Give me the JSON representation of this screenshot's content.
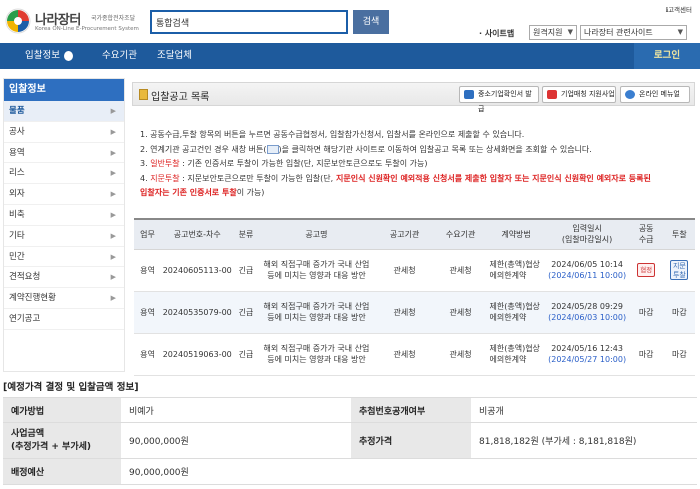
{
  "header": {
    "logo_title": "나라장터",
    "logo_sub1": "국가종합전자조달",
    "logo_sub2": "Korea ON-Line E-Procurement System",
    "search_select": "통합검색",
    "search_button": "검색",
    "help": "고객센터",
    "sitemap_label": "· 사이트맵",
    "dropdown1": "원격지원",
    "dropdown2": "나라장터 관련사이트"
  },
  "nav": {
    "items": [
      "입찰정보",
      "수요기관",
      "조달업체"
    ],
    "login": "로그인"
  },
  "sidebar": {
    "title": "입찰정보",
    "items": [
      "물품",
      "공사",
      "용역",
      "리스",
      "외자",
      "비축",
      "기타",
      "민간",
      "견적요청",
      "계약진행현황",
      "연기공고"
    ]
  },
  "content": {
    "title": "입찰공고 목록",
    "buttons": [
      "중소기업확인서 발급",
      "기업매칭 지원사업",
      "온라인 메뉴얼"
    ],
    "notices": {
      "n1": "1. 공동수급,투찰 항목의 버튼을 누르면 공동수급협정서, 입찰참가신청서, 입찰서를 온라인으로 제출할 수 있습니다.",
      "n2a": "2. 연계기관 공고건인 경우 새창 버튼(",
      "n2b": ")을 클릭하면 해당기관 사이트로 이동하여 입찰공고 목록 또는 상세화면을 조회할 수 있습니다.",
      "n3_prefix": "3. ",
      "n3_red": "일반투찰",
      "n3_rest": " : 기존 인증서로 투찰이 가능한 입찰(단, 지문보안토큰으로도 투찰이 가능)",
      "n4_prefix": "4. ",
      "n4_red": "지문투찰",
      "n4_rest": " : 지문보안토큰으로만 투찰이 가능한 입찰(단,",
      "n4_red2": " 지문인식 신원확인 예외적용 신청서를 제출한 입찰자 또는 지문인식 신원확인 예외자로 등록된",
      "n4_red3": "입찰자는 기존 인증서로 투찰",
      "n4_end": "이 가능)"
    },
    "table": {
      "headers": [
        "업무",
        "공고번호-차수",
        "분류",
        "공고명",
        "공고기관",
        "수요기관",
        "계약방법",
        "입력일시\n(입찰마감일시)",
        "공동\n수급",
        "투찰"
      ],
      "rows": [
        {
          "work": "용역",
          "no": "20240605113-00",
          "cat": "긴급",
          "name": "해외 직접구매 증가가 국내 산업 등에 미치는 영향과 대응 방안",
          "org": "관세청",
          "demand": "관세청",
          "method": "제한(총액)협상에의한계약",
          "date": "2024/06/05 10:14",
          "deadline": "(2024/06/11 10:00)",
          "joint": "협정",
          "bid": "지문\n투찰"
        },
        {
          "work": "용역",
          "no": "20240535079-00",
          "cat": "긴급",
          "name": "해외 직접구매 증가가 국내 산업 등에 미치는 영향과 대응 방안",
          "org": "관세청",
          "demand": "관세청",
          "method": "제한(총액)협상에의한계약",
          "date": "2024/05/28 09:29",
          "deadline": "(2024/06/03 10:00)",
          "joint": "마감",
          "bid": "마감"
        },
        {
          "work": "용역",
          "no": "20240519063-00",
          "cat": "긴급",
          "name": "해외 직접구매 증가가 국내 산업 등에 미치는 영향과 대응 방안",
          "org": "관세청",
          "demand": "관세청",
          "method": "제한(총액)협상에의한계약",
          "date": "2024/05/16 12:43",
          "deadline": "(2024/05/27 10:00)",
          "joint": "마감",
          "bid": "마감"
        }
      ]
    }
  },
  "info": {
    "title": "[예정가격 결정 및 입찰금액 정보]",
    "rows": [
      {
        "l1": "예가방법",
        "v1": "비예가",
        "l2": "추첨번호공개여부",
        "v2": "비공개"
      },
      {
        "l1": "사업금액\n(추정가격 + 부가세)",
        "v1": "90,000,000원",
        "l2": "추정가격",
        "v2": "81,818,182원  (부가세 : 8,181,818원)"
      },
      {
        "l1": "배정예산",
        "v1": "90,000,000원",
        "l2": "",
        "v2": ""
      }
    ]
  },
  "colors": {
    "nav": "#1e5a9c",
    "sidebar_title": "#2e6fc0",
    "green_link": "#2f9a2f",
    "blue_deadline": "#2a5fc8",
    "red": "#dd2222"
  }
}
